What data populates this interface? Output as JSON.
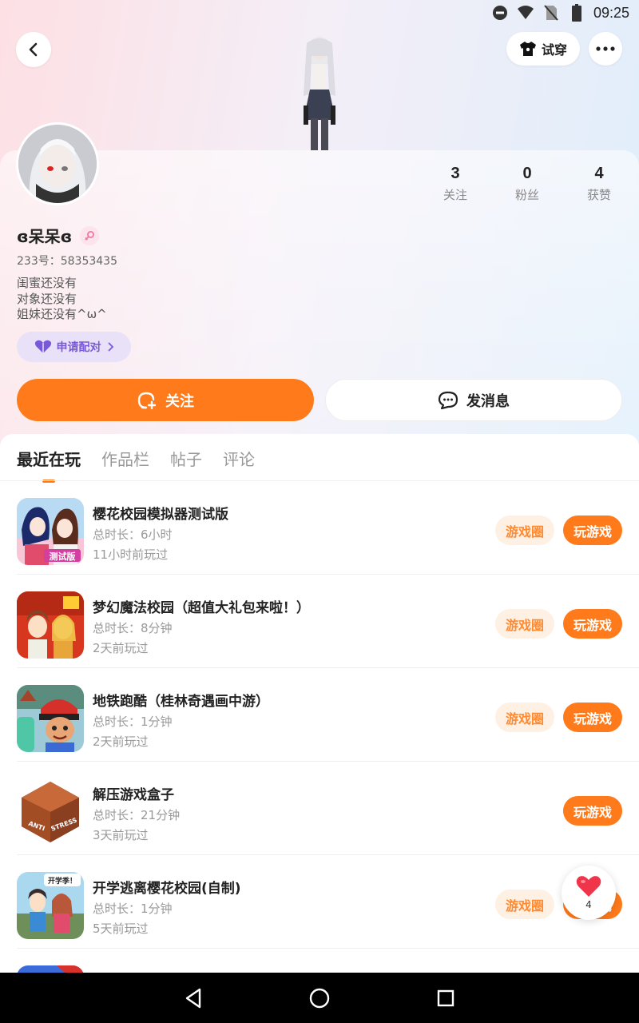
{
  "status_bar": {
    "time": "09:25"
  },
  "header": {
    "tryon_label": "试穿"
  },
  "profile": {
    "username": "ɞ呆呆ɞ",
    "uid": "233号：58353435",
    "bio_lines": [
      "闺蜜还没有",
      "对象还没有",
      "姐妹还没有^ω^"
    ],
    "stats": [
      {
        "value": "3",
        "label": "关注"
      },
      {
        "value": "0",
        "label": "粉丝"
      },
      {
        "value": "4",
        "label": "获赞"
      }
    ],
    "pair_label": "申请配对",
    "follow_label": "关注",
    "message_label": "发消息"
  },
  "tabs": [
    {
      "label": "最近在玩",
      "active": true
    },
    {
      "label": "作品栏",
      "active": false
    },
    {
      "label": "帖子",
      "active": false
    },
    {
      "label": "评论",
      "active": false
    }
  ],
  "games": [
    {
      "name": "樱花校园模拟器测试版",
      "duration": "总时长：6小时",
      "last_played": "11小时前玩过",
      "circle_label": "游戏圈",
      "play_label": "玩游戏",
      "icon_badge": "测试版"
    },
    {
      "name": "梦幻魔法校园（超值大礼包来啦！）",
      "duration": "总时长：8分钟",
      "last_played": "2天前玩过",
      "circle_label": "游戏圈",
      "play_label": "玩游戏"
    },
    {
      "name": "地铁跑酷（桂林奇遇画中游）",
      "duration": "总时长：1分钟",
      "last_played": "2天前玩过",
      "circle_label": "游戏圈",
      "play_label": "玩游戏"
    },
    {
      "name": "解压游戏盒子",
      "duration": "总时长：21分钟",
      "last_played": "3天前玩过",
      "play_label": "玩游戏",
      "icon_text_1": "ANTI",
      "icon_text_2": "STRESS"
    },
    {
      "name": "开学逃离樱花校园(自制)",
      "duration": "总时长：1分钟",
      "last_played": "5天前玩过",
      "circle_label": "游戏圈",
      "play_label": "玩游戏",
      "icon_badge": "开学季！"
    }
  ],
  "like_fab": {
    "count": "4"
  },
  "colors": {
    "accent": "#ff7a1a",
    "accent_light": "#fff0e4",
    "pair_bg": "#e8e1f8",
    "pair_fg": "#7a59d8"
  }
}
